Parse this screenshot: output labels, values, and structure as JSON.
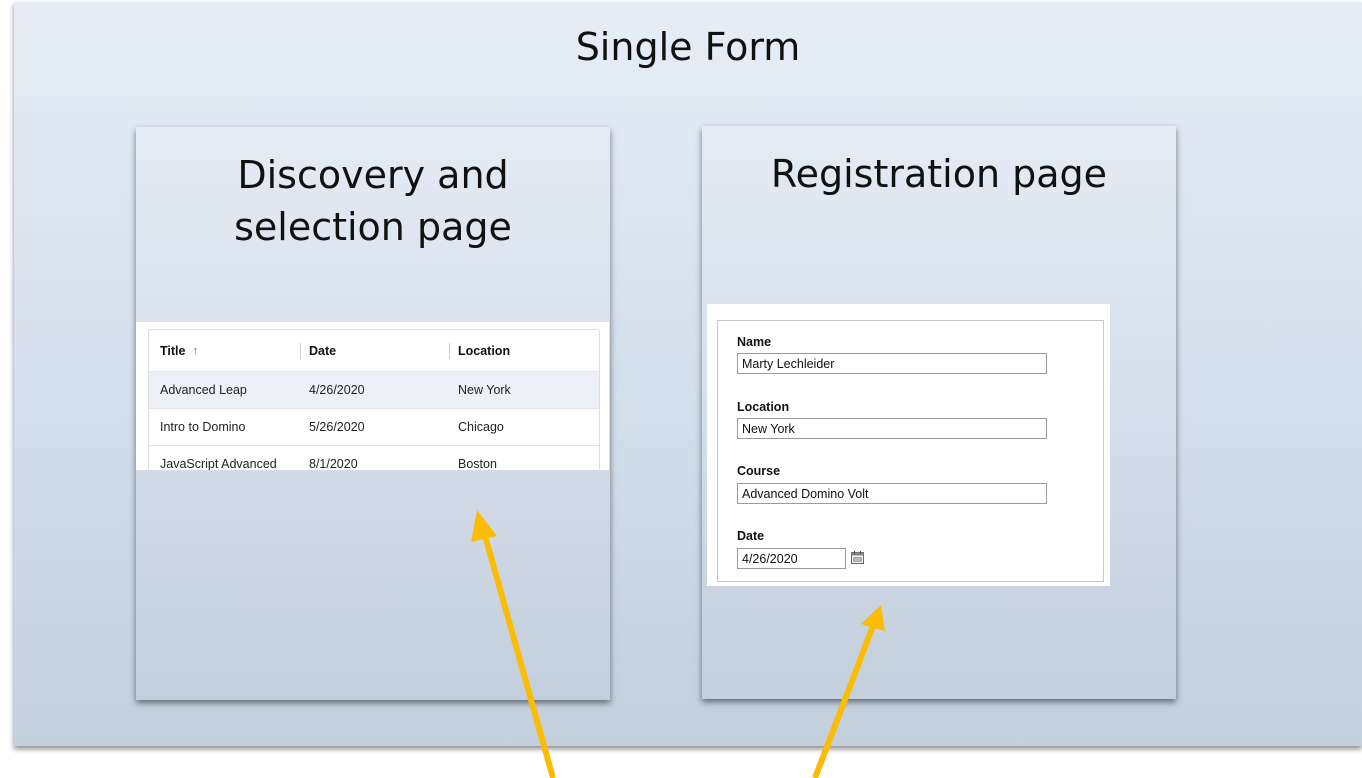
{
  "title": "Single Form",
  "panels": {
    "discovery": {
      "title_line1": "Discovery and",
      "title_line2": "selection page"
    },
    "registration": {
      "title": "Registration page"
    }
  },
  "table": {
    "columns": [
      "Title",
      "Date",
      "Location"
    ],
    "sort_icon": "↑",
    "rows": [
      {
        "title": "Advanced Leap",
        "date": "4/26/2020",
        "location": "New York",
        "selected": true
      },
      {
        "title": "Intro to Domino",
        "date": "5/26/2020",
        "location": "Chicago",
        "selected": false
      },
      {
        "title": "JavaScript Advanced",
        "date": "8/1/2020",
        "location": "Boston",
        "selected": false
      }
    ]
  },
  "form": {
    "name_label": "Name",
    "name_value": "Marty Lechleider",
    "location_label": "Location",
    "location_value": "New York",
    "course_label": "Course",
    "course_value": "Advanced Domino Volt",
    "date_label": "Date",
    "date_value": "4/26/2020",
    "calendar_icon": "calendar-icon"
  },
  "colors": {
    "arrow": "#fbbc05",
    "selected_row": "#edf1f7"
  }
}
